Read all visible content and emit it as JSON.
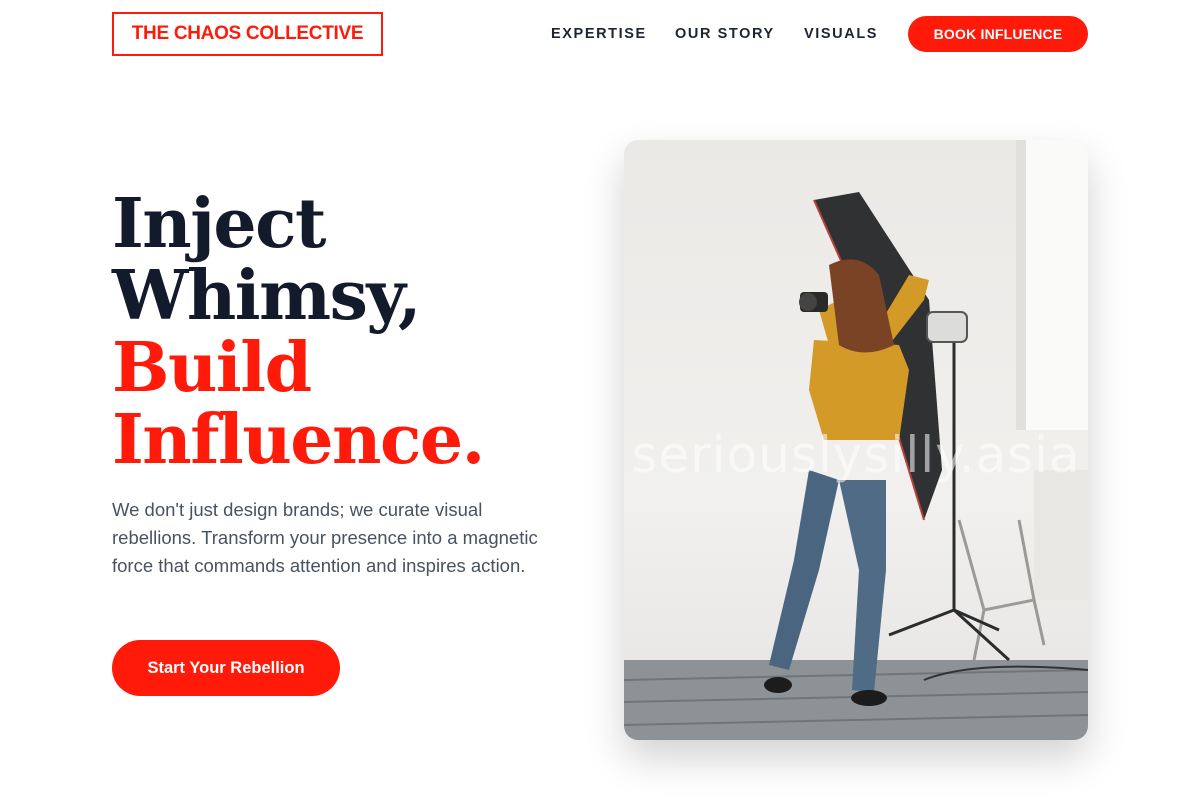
{
  "brand": {
    "name": "THE CHAOS COLLECTIVE",
    "accent": "#ff1a0a",
    "dark": "#131a2b"
  },
  "nav": {
    "items": [
      "EXPERTISE",
      "OUR STORY",
      "VISUALS"
    ],
    "cta_label": "BOOK INFLUENCE"
  },
  "hero": {
    "headline": {
      "line1": "Inject",
      "line2": "Whimsy,",
      "line3": "Build",
      "line4": "Influence."
    },
    "subtext": "We don't just design brands; we curate visual rebellions. Transform your presence into a magnetic force that commands attention and inspires action.",
    "cta_label": "Start Your Rebellion",
    "image": {
      "subject": "photographer-with-softbox-in-studio",
      "watermark": "seriouslysilly.asia"
    }
  }
}
